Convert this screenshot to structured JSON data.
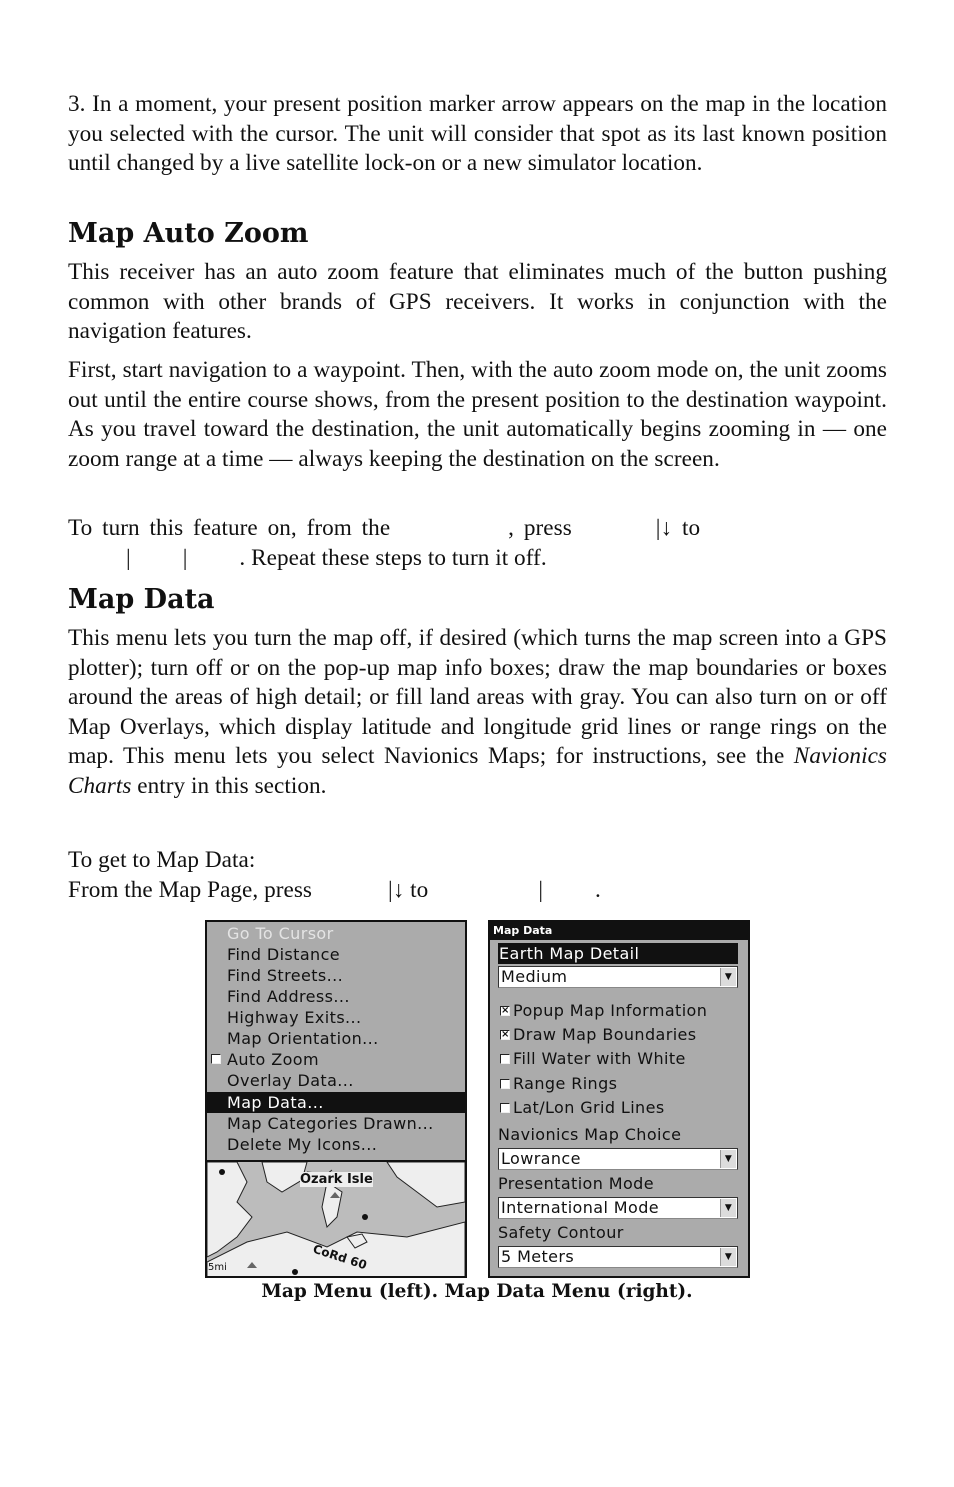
{
  "body": {
    "step3": "3. In a moment, your present position marker arrow appears on the map in the location you selected with the cursor. The unit will consider that spot as its last known position until changed by a live satellite lock-on or a new simulator location.",
    "auto_zoom": {
      "heading": "Map Auto Zoom",
      "para1": "This receiver has an auto zoom feature that eliminates much of the button pushing common with other brands of GPS receivers. It works in conjunction with the navigation features.",
      "para2": "First, start navigation to a waypoint. Then, with the auto zoom mode on, the unit zooms out until the entire course shows, from the present position to the destination waypoint. As you travel toward the destination, the unit automatically begins zooming in — one zoom range at a time — always keeping the destination on the screen.",
      "instr_line1_a": "To turn this feature on, from the",
      "instr_line1_b": ", press",
      "instr_line1_c": "|↓ to",
      "instr_line2_a": "|",
      "instr_line2_b": "|",
      "instr_line2_c": ". Repeat these steps to turn it off."
    },
    "map_data": {
      "heading": "Map Data",
      "para1_a": "This menu lets you turn the map off, if desired (which turns the map screen into a GPS plotter); turn off or on the pop-up map info boxes; draw the map boundaries or boxes around the areas of high detail; or fill land areas with gray. You can also turn on or off Map Overlays, which display latitude and longitude grid lines or range rings on the map. This menu lets you select Navionics Maps; for instructions, see the ",
      "para1_italic": "Navionics Charts",
      "para1_b": " entry in this section.",
      "get_to": "To get to Map Data:",
      "from_a": "From the Map Page, press",
      "from_b": "|↓ to",
      "from_c": "|",
      "from_d": "."
    }
  },
  "map_menu": {
    "items": [
      {
        "label": "Go To Cursor",
        "state": "disabled"
      },
      {
        "label": "Find Distance"
      },
      {
        "label": "Find Streets..."
      },
      {
        "label": "Find Address..."
      },
      {
        "label": "Highway Exits..."
      },
      {
        "label": "Map Orientation..."
      },
      {
        "label": "Auto Zoom",
        "checkbox": false
      },
      {
        "label": "Overlay Data..."
      },
      {
        "label": "Map Data...",
        "state": "selected"
      },
      {
        "label": "Map Categories Drawn..."
      },
      {
        "label": "Delete My Icons..."
      }
    ],
    "map_preview": {
      "place_label": "Ozark Isle",
      "road_label": "CoRd 60",
      "scale_label": "5mi"
    }
  },
  "map_data_menu": {
    "title": "Map Data",
    "earth_detail_label": "Earth Map Detail",
    "earth_detail_value": "Medium",
    "checkboxes": [
      {
        "label": "Popup Map Information",
        "checked": true
      },
      {
        "label": "Draw Map Boundaries",
        "checked": true
      },
      {
        "label": "Fill Water with White",
        "checked": false
      },
      {
        "label": "Range Rings",
        "checked": false
      },
      {
        "label": "Lat/Lon Grid Lines",
        "checked": false
      }
    ],
    "navionics_label": "Navionics Map Choice",
    "navionics_value": "Lowrance",
    "presentation_label": "Presentation Mode",
    "presentation_value": "International Mode",
    "safety_label": "Safety Contour",
    "safety_value": "5 Meters",
    "check_mark": "×",
    "dropdown_arrow": "▼"
  },
  "caption": "Map Menu (left). Map Data Menu (right)."
}
